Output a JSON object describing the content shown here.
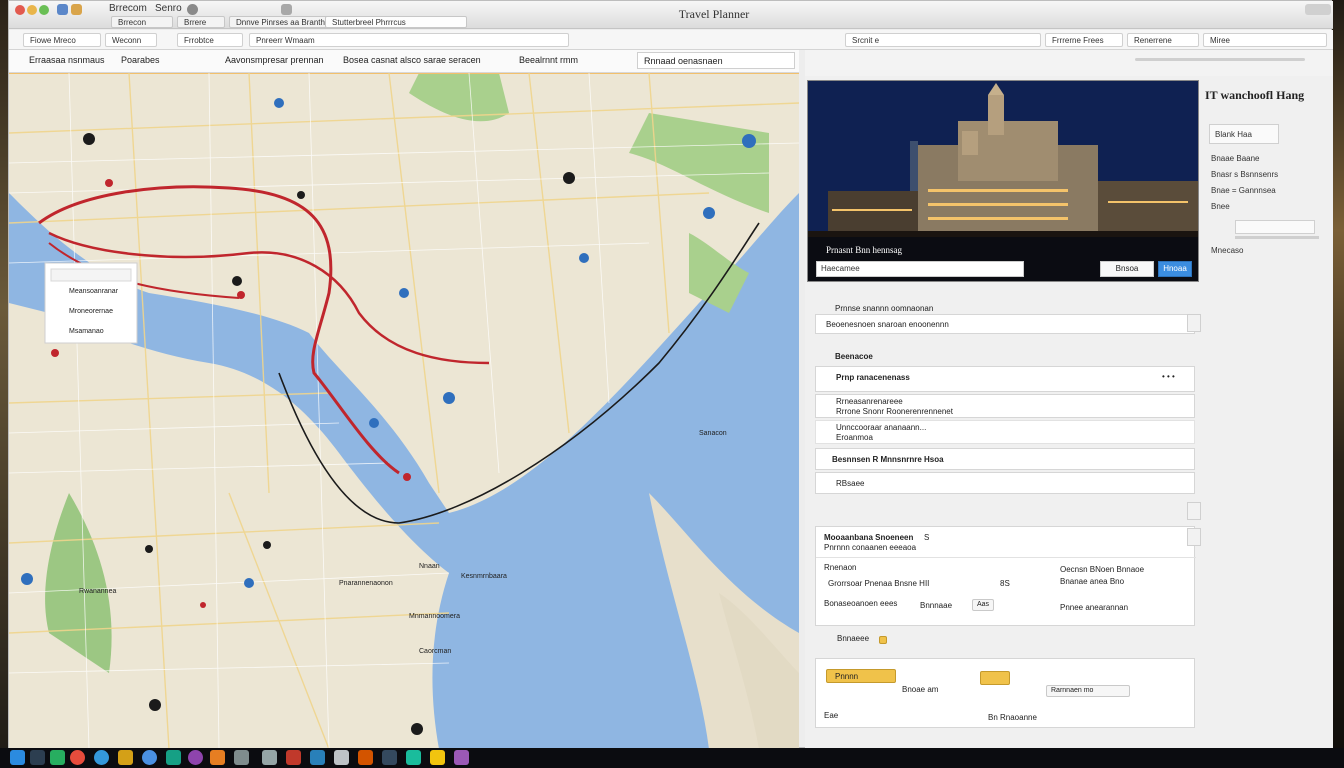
{
  "window": {
    "title": "Travel Planner",
    "app_name": "Brrecom",
    "app_menu": "Senro",
    "tabs": [
      "Brrecon",
      "Brrere",
      "Dnnve Pinrses aa Branthas",
      "Stutterbreel Phrrrcus"
    ],
    "nav_items": [
      "Fiowe Mreco",
      "Weconn",
      "Frrobtce",
      "Pnreerr Wmaam",
      "Srcnit e",
      "Frrrerne Frees",
      "Renerrene",
      "Miree"
    ]
  },
  "secondary_bar": {
    "items": [
      "Erraasaa nsnmaus",
      "Poarabes",
      "Aavonsmpresar prennan",
      "Bosea casnat alsco sarae seracen",
      "Beealrnnt rmm"
    ],
    "selected": "Rnnaad oenasnaen"
  },
  "map": {
    "legend_items": [
      "Meansoanranar",
      "Mroneorernae",
      "Msamanao"
    ],
    "place_labels": [
      "Nnaan",
      "Kesnmrnbaara",
      "Pnarannenaonon",
      "Rwanannea",
      "Mnmannoomera",
      "Caorcman",
      "Sanacon"
    ]
  },
  "hero": {
    "caption": "Prnasnt Bnn hennsag",
    "input_value": "Haecamee",
    "btn_secondary": "Bnsoa",
    "btn_primary": "Hnoaa"
  },
  "side": {
    "title": "IT wanchoofl Hang",
    "rows": [
      "Blank Haa",
      "Bnaae   Baane",
      "Bnasr  s  Bsnnsenrs",
      "Bnae  =  Gannnsea",
      "Bnee",
      "Mnecaso"
    ]
  },
  "itinerary": {
    "header": "Prnnse snannn oomnaonan",
    "search_value": "Beoenesnoen snaroan enoonennn",
    "section_1": "Beenacoe",
    "flight_title": "Prnp ranacenenass",
    "flight_time": "• • •",
    "detail_1": "Rrneasanrenareee",
    "detail_2": "Rrrone Snonr Roonerenrennenet",
    "detail_3": "Unnccooraar ananaann...",
    "detail_4": "Eroanmoa",
    "segment_title": "Besnnsen R Mnnsnrnre Hsoa",
    "segment_sub": "RBsaee",
    "stay_title": "Mooaanbana Snoeneen",
    "stay_meta": "S",
    "stay_sub": "Pnrnnn conaanen eeeaoa",
    "stay_note": "Rnenaon",
    "stay_row": "Grorrsoar  Pnenaa  Bnsne  HII",
    "stay_time": "8S",
    "right_block_title": "Oecnsn BNoen  Bnnaoe",
    "right_block_sub": "Bnanae anea  Bno",
    "right_block_extra": "Pnnee  anearannan",
    "foot_a": "Bonaseoanoen  eees",
    "foot_b": "Bnnnaae",
    "foot_c": "Aas",
    "booking_label": "Bnnaeee",
    "booking_tag": "Pnnnn",
    "booking_mid": "Bnoae  am",
    "booking_btn": "Rarnnaen  mo",
    "booking_small_1": "Eae",
    "booking_small_2": "Bn  Rnaoanne"
  },
  "colors": {
    "route": "#c0262d",
    "water": "#8fb6e2",
    "accent": "#3b8de0",
    "gold": "#f0c24a"
  }
}
